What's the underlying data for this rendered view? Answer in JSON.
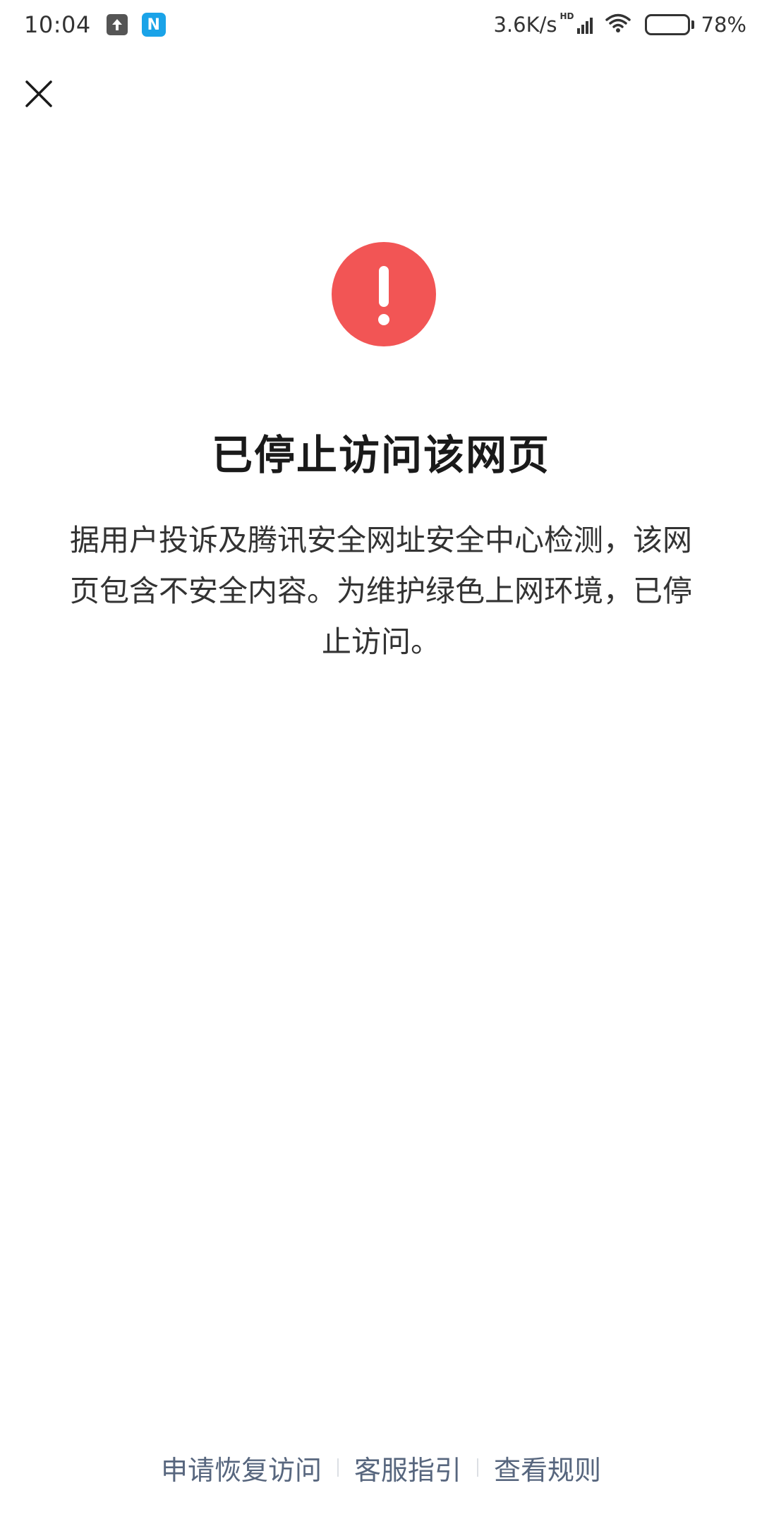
{
  "status_bar": {
    "time": "10:04",
    "notification_icons": [
      "upload-arrow-icon",
      "app-n-icon"
    ],
    "app_letter": "N",
    "network_speed": "3.6K/s",
    "hd_label": "HD",
    "battery_level": 0.78,
    "battery_text": "78%"
  },
  "header": {
    "close_icon": "close-icon"
  },
  "main": {
    "icon": "exclamation-icon",
    "icon_color": "#f25555",
    "title": "已停止访问该网页",
    "description": "据用户投诉及腾讯安全网址安全中心检测，该网页包含不安全内容。为维护绿色上网环境，已停止访问。"
  },
  "footer": {
    "links": [
      {
        "label": "申请恢复访问"
      },
      {
        "label": "客服指引"
      },
      {
        "label": "查看规则"
      }
    ],
    "link_color": "#57667e"
  }
}
